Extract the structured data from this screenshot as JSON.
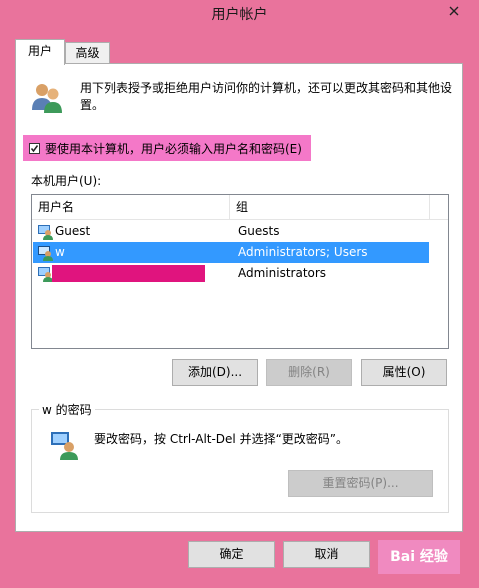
{
  "window": {
    "title": "用户帐户"
  },
  "tabs": [
    {
      "label": "用户",
      "active": true
    },
    {
      "label": "高级",
      "active": false
    }
  ],
  "info": {
    "text": "用下列表授予或拒绝用户访问你的计算机，还可以更改其密码和其他设置。",
    "icon": "users-icon"
  },
  "require_login": {
    "label": "要使用本计算机，用户必须输入用户名和密码(E)",
    "checked": true
  },
  "list": {
    "label": "本机用户(U):",
    "columns": [
      "用户名",
      "组"
    ],
    "rows": [
      {
        "name": "Guest",
        "group": "Guests",
        "selected": false
      },
      {
        "name": "w",
        "group": "Administrators; Users",
        "selected": true
      },
      {
        "name": "",
        "group": "Administrators",
        "selected": false,
        "redacted": true
      }
    ]
  },
  "buttons": {
    "add": "添加(D)...",
    "remove": "删除(R)",
    "properties": "属性(O)",
    "reset_password": "重置密码(P)...",
    "ok": "确定",
    "cancel": "取消"
  },
  "password": {
    "group_title": "w 的密码",
    "text": "要改密码，按 Ctrl-Alt-Del 并选择“更改密码”。"
  },
  "colors": {
    "background": "#e9739c",
    "selection": "#3399ff",
    "highlight": "#f478c8"
  }
}
